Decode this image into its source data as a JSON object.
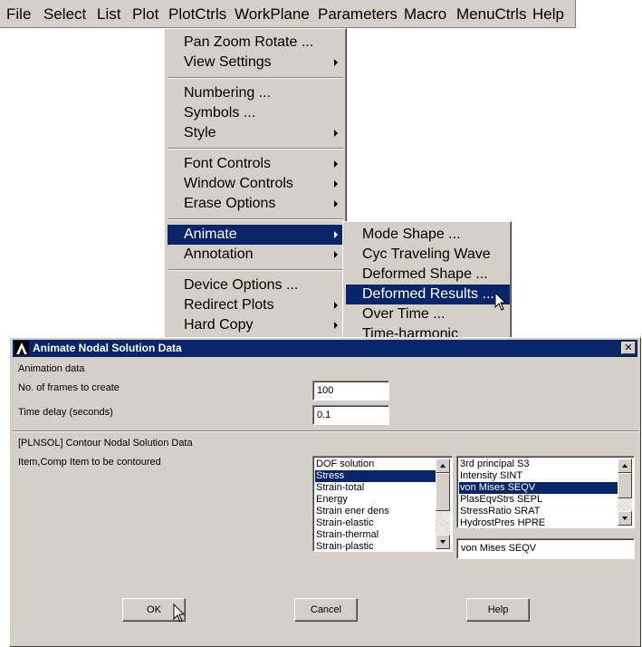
{
  "menubar": {
    "items": [
      "File",
      "Select",
      "List",
      "Plot",
      "PlotCtrls",
      "WorkPlane",
      "Parameters",
      "Macro",
      "MenuCtrls",
      "Help"
    ]
  },
  "plotctrls_menu": {
    "pan_zoom_rotate": "Pan Zoom Rotate ...",
    "view_settings": "View Settings",
    "numbering": "Numbering ...",
    "symbols": "Symbols ...",
    "style": "Style",
    "font_controls": "Font Controls",
    "window_controls": "Window Controls",
    "erase_options": "Erase Options",
    "animate": "Animate",
    "annotation": "Annotation",
    "device_options": "Device Options ...",
    "redirect_plots": "Redirect Plots",
    "hard_copy": "Hard Copy"
  },
  "animate_menu": {
    "mode_shape": "Mode Shape ...",
    "cyc_traveling_wave": "Cyc Traveling Wave",
    "deformed_shape": "Deformed Shape ...",
    "deformed_results": "Deformed Results ...",
    "over_time": "Over Time ...",
    "time_harmonic": "Time-harmonic"
  },
  "dialog": {
    "title": "Animate Nodal Solution Data",
    "close_glyph": "✕",
    "animation_data_label": "Animation data",
    "frames_label": "No. of frames to create",
    "frames_value": "100",
    "delay_label": "Time delay (seconds)",
    "delay_value": "0.1",
    "plnsol_label": "[PLNSOL]  Contour Nodal Solution Data",
    "item_comp_label": "Item,Comp   Item to be contoured",
    "item_list": [
      "DOF solution",
      "Stress",
      "Strain-total",
      "Energy",
      "Strain ener dens",
      "Strain-elastic",
      "Strain-thermal",
      "Strain-plastic"
    ],
    "item_selected": "Stress",
    "comp_list": [
      "3rd principal S3",
      "Intensity   SINT",
      "von Mises   SEQV",
      "PlasEqvStrs SEPL",
      "StressRatio SRAT",
      "HydrostPres HPRE"
    ],
    "comp_selected": "von Mises   SEQV",
    "comp_value": "von Mises   SEQV",
    "ok": "OK",
    "cancel": "Cancel",
    "help": "Help"
  },
  "colors": {
    "face": "#d4d0c8",
    "highlight": "#0a246a"
  }
}
